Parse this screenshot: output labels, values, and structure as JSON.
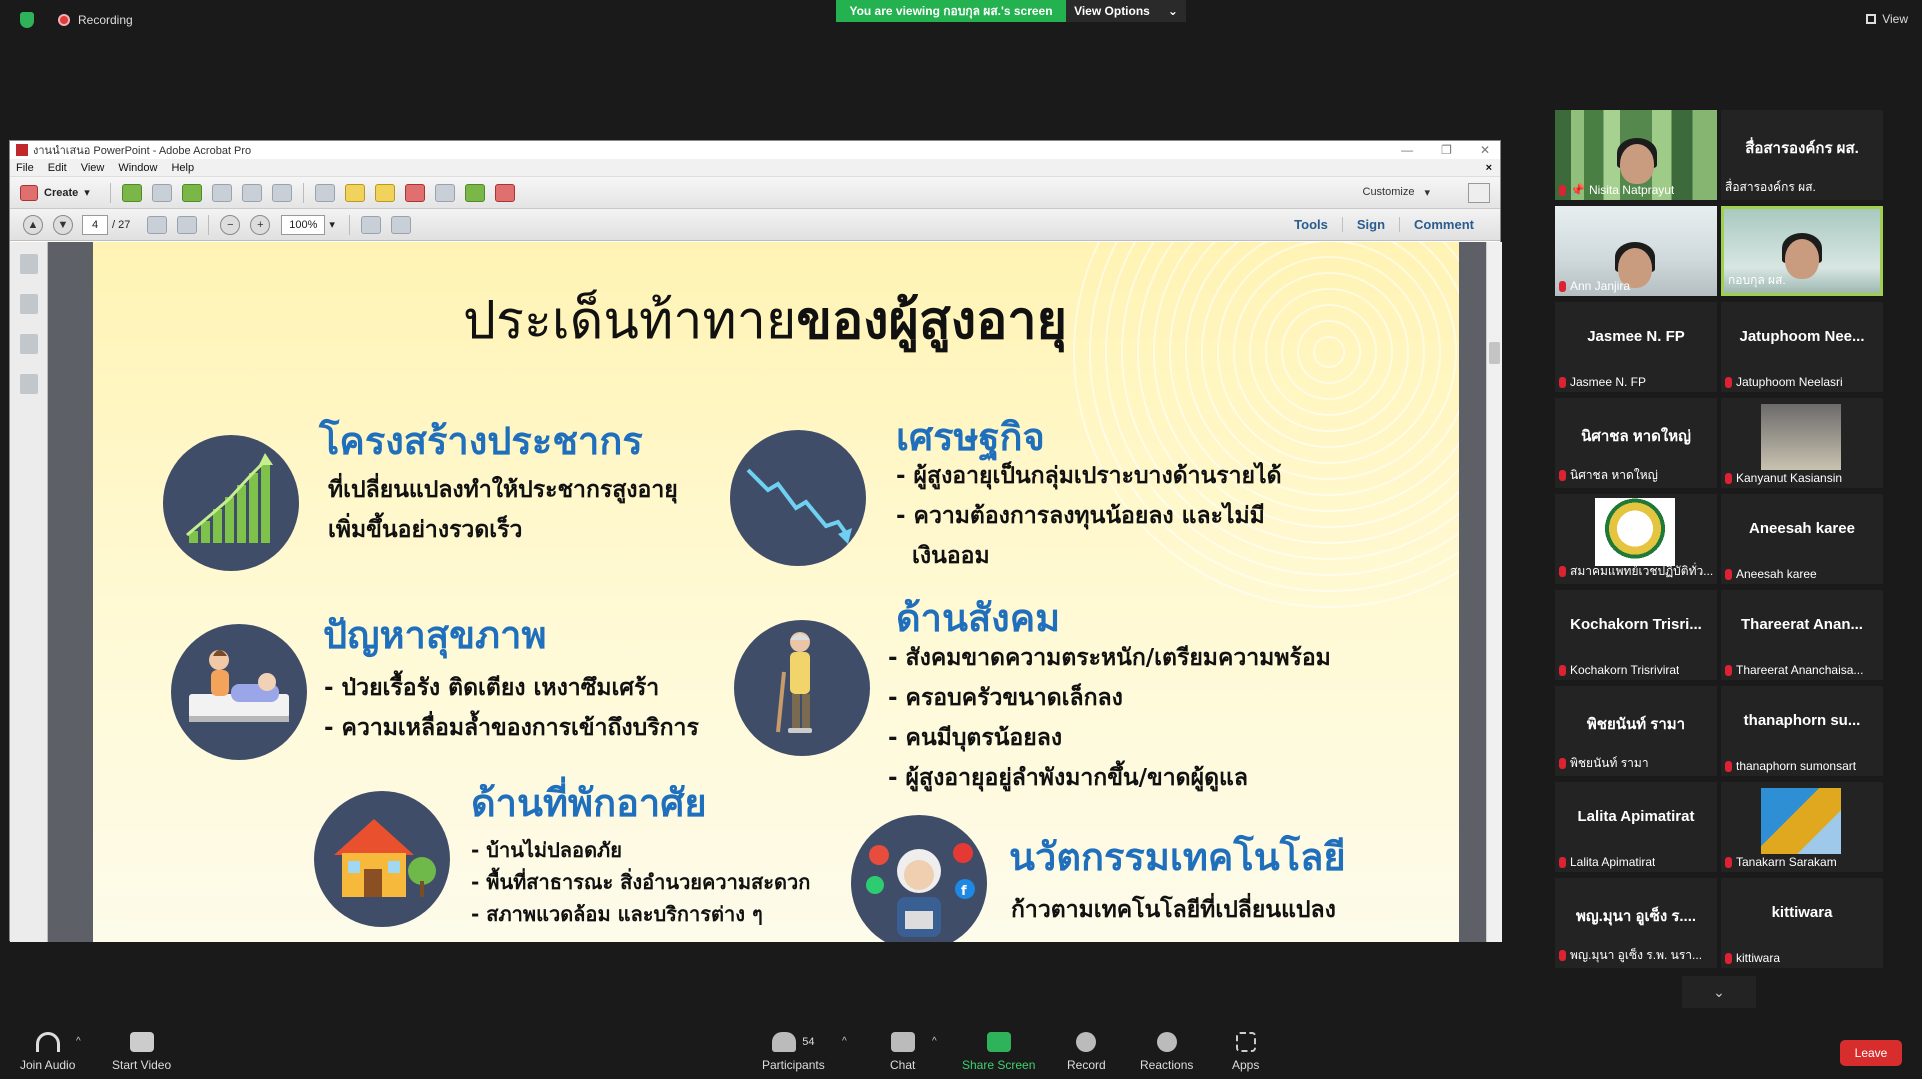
{
  "topbar": {
    "recording": "Recording",
    "viewing_banner": "You are viewing กอบกุล ผส.'s screen",
    "view_options": "View Options",
    "view_button": "View"
  },
  "acrobat": {
    "title": "งานนำเสนอ PowerPoint - Adobe Acrobat Pro",
    "menu": [
      "File",
      "Edit",
      "View",
      "Window",
      "Help"
    ],
    "create_label": "Create",
    "customize_label": "Customize",
    "page_current": "4",
    "page_total": "/ 27",
    "zoom": "100%",
    "right_tools": [
      "Tools",
      "Sign",
      "Comment"
    ]
  },
  "slide": {
    "title_normal": "ประเด็นท้าทาย",
    "title_bold": "ของผู้สูงอายุ",
    "sections": {
      "population": {
        "heading": "โครงสร้างประชากร",
        "lines": [
          "ที่เปลี่ยนแปลงทำให้ประชากรสูงอายุ",
          "เพิ่มขึ้นอย่างรวดเร็ว"
        ]
      },
      "economy": {
        "heading": "เศรษฐกิจ",
        "lines": [
          "- ผู้สูงอายุเป็นกลุ่มเปราะบางด้านรายได้",
          "- ความต้องการลงทุนน้อยลง และไม่มี",
          "  เงินออม"
        ]
      },
      "health": {
        "heading": "ปัญหาสุขภาพ",
        "lines": [
          "- ป่วยเรื้อรัง  ติดเตียง  เหงาซึมเศร้า",
          "- ความเหลื่อมล้ำของการเข้าถึงบริการ"
        ]
      },
      "social": {
        "heading": "ด้านสังคม",
        "lines": [
          "- สังคมขาดความตระหนัก/เตรียมความพร้อม",
          "- ครอบครัวขนาดเล็กลง",
          "- คนมีบุตรน้อยลง",
          "- ผู้สูงอายุอยู่ลำพังมากขึ้น/ขาดผู้ดูแล"
        ]
      },
      "housing": {
        "heading": "ด้านที่พักอาศัย",
        "lines": [
          "- บ้านไม่ปลอดภัย",
          "- พื้นที่สาธารณะ สิ่งอำนวยความสะดวก",
          "- สภาพแวดล้อม และบริการต่าง ๆ"
        ]
      },
      "technology": {
        "heading": "นวัตกรรมเทคโนโลยี",
        "lines": [
          "ก้าวตามเทคโนโลยีที่เปลี่ยนแปลง"
        ]
      }
    }
  },
  "participants": [
    {
      "big": "",
      "name": "Nisita Natprayut",
      "pinned": true
    },
    {
      "big": "สื่อสารองค์กร ผส.",
      "name": "สื่อสารองค์กร ผส."
    },
    {
      "big": "",
      "name": "Ann Janjira"
    },
    {
      "big": "",
      "name": "กอบกุล ผส.",
      "active": true
    },
    {
      "big": "Jasmee N. FP",
      "name": "Jasmee N. FP"
    },
    {
      "big": "Jatuphoom  Nee...",
      "name": "Jatuphoom Neelasri"
    },
    {
      "big": "นิศาชล หาดใหญ่",
      "name": "นิศาชล หาดใหญ่"
    },
    {
      "big": "",
      "name": "Kanyanut Kasiansin"
    },
    {
      "big": "",
      "name": "สมาคมแพทย์เวชปฏิบัติทั่ว..."
    },
    {
      "big": "Aneesah karee",
      "name": "Aneesah karee"
    },
    {
      "big": "Kochakorn  Trisri...",
      "name": "Kochakorn Trisrivirat"
    },
    {
      "big": "Thareerat  Anan...",
      "name": "Thareerat Ananchaisa..."
    },
    {
      "big": "พิชยนันท์ รามา",
      "name": "พิชยนันท์ รามา"
    },
    {
      "big": "thanaphorn  su...",
      "name": "thanaphorn sumonsart"
    },
    {
      "big": "Lalita Apimatirat",
      "name": "Lalita Apimatirat"
    },
    {
      "big": "",
      "name": "Tanakarn Sarakam"
    },
    {
      "big": "พญ.มุนา อูเซ็ง ร....",
      "name": "พญ.มุนา อูเซ็ง ร.พ. นรา..."
    },
    {
      "big": "kittiwara",
      "name": "kittiwara"
    }
  ],
  "bottombar": {
    "join_audio": "Join Audio",
    "start_video": "Start Video",
    "participants_label": "Participants",
    "participants_count": "54",
    "chat": "Chat",
    "share_screen": "Share Screen",
    "record": "Record",
    "reactions": "Reactions",
    "apps": "Apps",
    "leave": "Leave"
  },
  "colors": {
    "zoom_green": "#24b14f",
    "heading_blue": "#1f6fbd",
    "icon_circle": "#3f4d68",
    "leave_red": "#d72d2d"
  }
}
